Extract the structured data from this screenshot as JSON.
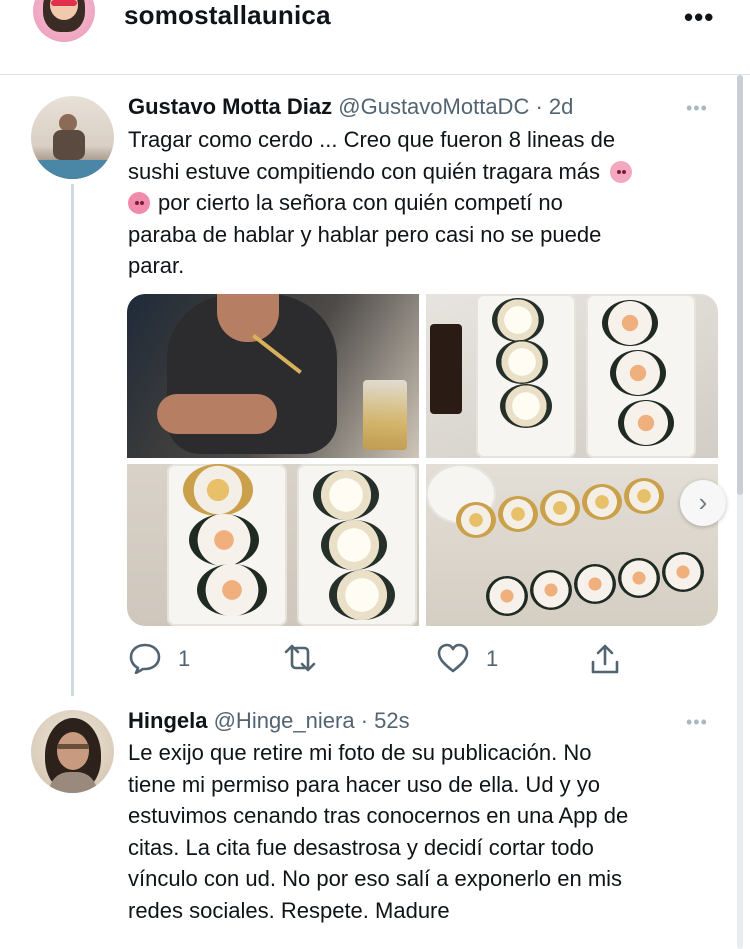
{
  "profile": {
    "username": "somostallaunica",
    "more_label": "•••"
  },
  "tweet1": {
    "name": "Gustavo Motta Diaz",
    "handle": "@GustavoMottaDC",
    "separator": "·",
    "time": "2d",
    "more_label": "•••",
    "text_lines": [
      "Tragar como cerdo ... Creo que fueron 8 lineas de",
      "sushi estuve compitiendo con quién tragara más",
      "por cierto la señora con quién competí no",
      "paraba de hablar y hablar pero casi no se puede",
      "parar."
    ],
    "media_icons": [
      "pig-face-emoji",
      "pig-nose-emoji"
    ],
    "actions": {
      "reply_count": "1",
      "like_count": "1"
    }
  },
  "tweet2": {
    "name": "Hingela",
    "handle": "@Hinge_niera",
    "separator": "·",
    "time": "52s",
    "more_label": "•••",
    "text_lines": [
      "Le exijo que retire mi foto de su publicación. No",
      "tiene mi permiso para hacer uso de ella. Ud y yo",
      "estuvimos cenando tras conocernos en una App de",
      "citas. La cita fue desastrosa y decidí cortar todo",
      "vínculo con ud. No por eso salí a exponerlo en mis",
      "redes sociales. Respete. Madure"
    ]
  },
  "colors": {
    "text": "#0f1419",
    "secondary": "#536471",
    "divider": "#dcdfe3",
    "thread_line": "#cfd9de"
  }
}
